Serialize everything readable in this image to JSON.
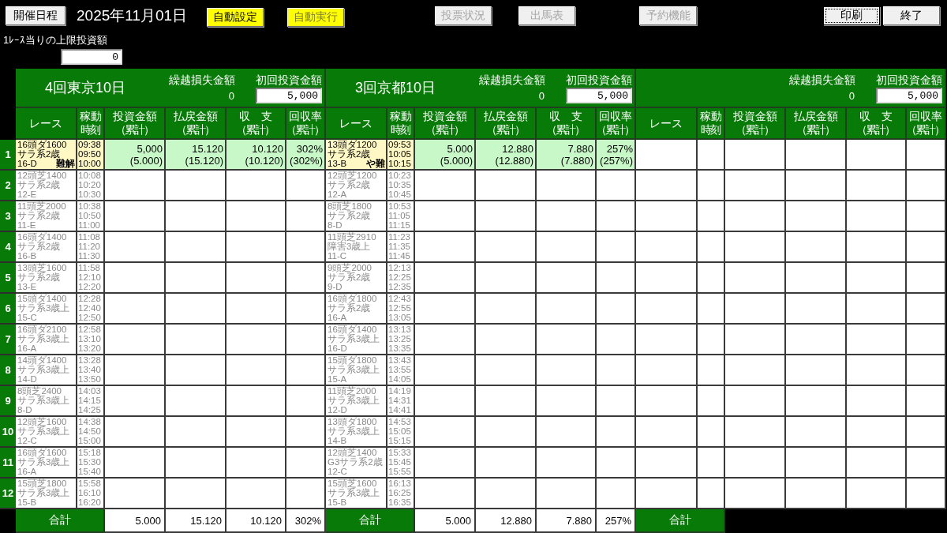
{
  "toolbar": [
    {
      "kind": "button",
      "label": "開催日程",
      "highlighted": false,
      "disabled": false,
      "focused": false
    },
    {
      "kind": "date",
      "label": "2025年11月01日"
    },
    {
      "kind": "button",
      "label": "自動設定",
      "highlighted": true,
      "disabled": false,
      "focused": false
    },
    {
      "kind": "button",
      "label": "自動実行",
      "highlighted": true,
      "disabled": true,
      "focused": false
    },
    {
      "kind": "button",
      "label": "投票状況",
      "highlighted": false,
      "disabled": true,
      "focused": false
    },
    {
      "kind": "button",
      "label": "出馬表",
      "highlighted": false,
      "disabled": true,
      "focused": false
    },
    {
      "kind": "button",
      "label": "予約機能",
      "highlighted": false,
      "disabled": true,
      "focused": false
    },
    {
      "kind": "button",
      "label": "印刷",
      "highlighted": false,
      "disabled": false,
      "focused": true
    },
    {
      "kind": "button",
      "label": "終了",
      "highlighted": false,
      "disabled": false,
      "focused": false
    }
  ],
  "bet_limit": {
    "label": "1ﾚｰｽ当りの上限投資額",
    "value": "0"
  },
  "row_numbers": [
    "1",
    "2",
    "3",
    "4",
    "5",
    "6",
    "7",
    "8",
    "9",
    "10",
    "11",
    "12"
  ],
  "panels": [
    {
      "title": "4回東京10日",
      "carryover": {
        "label": "繰越損失金額",
        "value": "0"
      },
      "initial_bet": {
        "label": "初回投資金額",
        "value": "5,000"
      },
      "columns": [
        [
          "レース"
        ],
        [
          "稼動",
          "時刻"
        ],
        [
          "投資金額",
          "（累計）"
        ],
        [
          "払戻金額",
          "（累計）"
        ],
        [
          "収　支",
          "（累計）"
        ],
        [
          "回収率",
          "（累計）"
        ]
      ],
      "rows": [
        {
          "selected": true,
          "race": [
            "16頭ダ1600",
            "サラ系2歳",
            "16-D"
          ],
          "note": "難解",
          "times": [
            "09:38",
            "09:50",
            "10:00"
          ],
          "amounts": [
            {
              "value": "5,000",
              "cumulative": "(5.000)"
            },
            {
              "value": "15.120",
              "cumulative": "(15.120)"
            },
            {
              "value": "10.120",
              "cumulative": "(10.120)"
            },
            {
              "value": "302%",
              "cumulative": "(302%)"
            }
          ]
        },
        {
          "selected": false,
          "race": [
            "12頭芝1400",
            "サラ系2歳",
            "12-E"
          ],
          "times": [
            "10:08",
            "10:20",
            "10:30"
          ]
        },
        {
          "selected": false,
          "race": [
            "11頭芝2000",
            "サラ系2歳",
            "11-E"
          ],
          "times": [
            "10:38",
            "10:50",
            "11:00"
          ]
        },
        {
          "selected": false,
          "race": [
            "16頭ダ1400",
            "サラ系2歳",
            "16-B"
          ],
          "times": [
            "11:08",
            "11:20",
            "11:30"
          ]
        },
        {
          "selected": false,
          "race": [
            "13頭芝1600",
            "サラ系2歳",
            "13-E"
          ],
          "times": [
            "11:58",
            "12:10",
            "12:20"
          ]
        },
        {
          "selected": false,
          "race": [
            "15頭ダ1400",
            "サラ系3歳上",
            "15-C"
          ],
          "times": [
            "12:28",
            "12:40",
            "12:50"
          ]
        },
        {
          "selected": false,
          "race": [
            "16頭ダ2100",
            "サラ系3歳上",
            "16-A"
          ],
          "times": [
            "12:58",
            "13:10",
            "13:20"
          ]
        },
        {
          "selected": false,
          "race": [
            "14頭ダ1400",
            "サラ系3歳上",
            "14-D"
          ],
          "times": [
            "13:28",
            "13:40",
            "13:50"
          ]
        },
        {
          "selected": false,
          "race": [
            "8頭芝2400",
            "サラ系3歳上",
            "8-D"
          ],
          "times": [
            "14:03",
            "14:15",
            "14:25"
          ]
        },
        {
          "selected": false,
          "race": [
            "12頭芝1600",
            "サラ系3歳上",
            "12-C"
          ],
          "times": [
            "14:38",
            "14:50",
            "15:00"
          ]
        },
        {
          "selected": false,
          "race": [
            "16頭ダ1600",
            "サラ系3歳上",
            "16-A"
          ],
          "times": [
            "15:18",
            "15:30",
            "15:40"
          ]
        },
        {
          "selected": false,
          "race": [
            "15頭芝1800",
            "サラ系3歳上",
            "15-B"
          ],
          "times": [
            "15:58",
            "16:10",
            "16:20"
          ]
        }
      ],
      "totals": {
        "label": "合計",
        "values": [
          "5.000",
          "15.120",
          "10.120",
          "302%"
        ]
      }
    },
    {
      "title": "3回京都10日",
      "carryover": {
        "label": "繰越損失金額",
        "value": "0"
      },
      "initial_bet": {
        "label": "初回投資金額",
        "value": "5,000"
      },
      "columns": [
        [
          "レース"
        ],
        [
          "稼動",
          "時刻"
        ],
        [
          "投資金額",
          "（累計）"
        ],
        [
          "払戻金額",
          "（累計）"
        ],
        [
          "収　支",
          "（累計）"
        ],
        [
          "回収率",
          "（累計）"
        ]
      ],
      "rows": [
        {
          "selected": true,
          "race": [
            "13頭ダ1200",
            "サラ系2歳",
            "13-B"
          ],
          "note": "や難",
          "times": [
            "09:53",
            "10:05",
            "10:15"
          ],
          "amounts": [
            {
              "value": "5.000",
              "cumulative": "(5.000)"
            },
            {
              "value": "12.880",
              "cumulative": "(12.880)"
            },
            {
              "value": "7.880",
              "cumulative": "(7.880)"
            },
            {
              "value": "257%",
              "cumulative": "(257%)"
            }
          ]
        },
        {
          "selected": false,
          "race": [
            "12頭芝1200",
            "サラ系2歳",
            "12-A"
          ],
          "times": [
            "10:23",
            "10:35",
            "10:45"
          ]
        },
        {
          "selected": false,
          "race": [
            "8頭芝1800",
            "サラ系2歳",
            "8-D"
          ],
          "times": [
            "10:53",
            "11:05",
            "11:15"
          ]
        },
        {
          "selected": false,
          "race": [
            "11頭芝2910",
            "障害3歳上",
            "11-C"
          ],
          "times": [
            "11:23",
            "11:35",
            "11:45"
          ]
        },
        {
          "selected": false,
          "race": [
            "9頭芝2000",
            "サラ系2歳",
            "9-D"
          ],
          "times": [
            "12:13",
            "12:25",
            "12:35"
          ]
        },
        {
          "selected": false,
          "race": [
            "16頭ダ1800",
            "サラ系2歳",
            "16-A"
          ],
          "times": [
            "12:43",
            "12:55",
            "13:05"
          ]
        },
        {
          "selected": false,
          "race": [
            "16頭ダ1400",
            "サラ系3歳上",
            "16-D"
          ],
          "times": [
            "13:13",
            "13:25",
            "13:35"
          ]
        },
        {
          "selected": false,
          "race": [
            "15頭ダ1800",
            "サラ系3歳上",
            "15-A"
          ],
          "times": [
            "13:43",
            "13:55",
            "14:05"
          ]
        },
        {
          "selected": false,
          "race": [
            "11頭芝2000",
            "サラ系3歳上",
            "12-D"
          ],
          "times": [
            "14:19",
            "14:31",
            "14:41"
          ]
        },
        {
          "selected": false,
          "race": [
            "13頭ダ1800",
            "サラ系3歳上",
            "14-B"
          ],
          "times": [
            "14:53",
            "15:05",
            "15:15"
          ]
        },
        {
          "selected": false,
          "race": [
            "12頭芝1400",
            "G3サラ系2歳",
            "12-C"
          ],
          "times": [
            "15:33",
            "15:45",
            "15:55"
          ]
        },
        {
          "selected": false,
          "race": [
            "15頭芝1600",
            "サラ系3歳上",
            "15-B"
          ],
          "times": [
            "16:13",
            "16:25",
            "16:35"
          ]
        }
      ],
      "totals": {
        "label": "合計",
        "values": [
          "5.000",
          "12.880",
          "7.880",
          "257%"
        ]
      }
    },
    {
      "carryover": {
        "label": "繰越損失金額",
        "value": "0"
      },
      "initial_bet": {
        "label": "初回投資金額",
        "value": "5,000"
      },
      "columns": [
        [
          "レース"
        ],
        [
          "稼動",
          "時刻"
        ],
        [
          "投資金額",
          "（累計）"
        ],
        [
          "払戻金額",
          "（累計）"
        ],
        [
          "収　支",
          "（累計）"
        ],
        [
          "回収率",
          "（累計）"
        ]
      ],
      "totals": {
        "label": "合計"
      }
    }
  ]
}
